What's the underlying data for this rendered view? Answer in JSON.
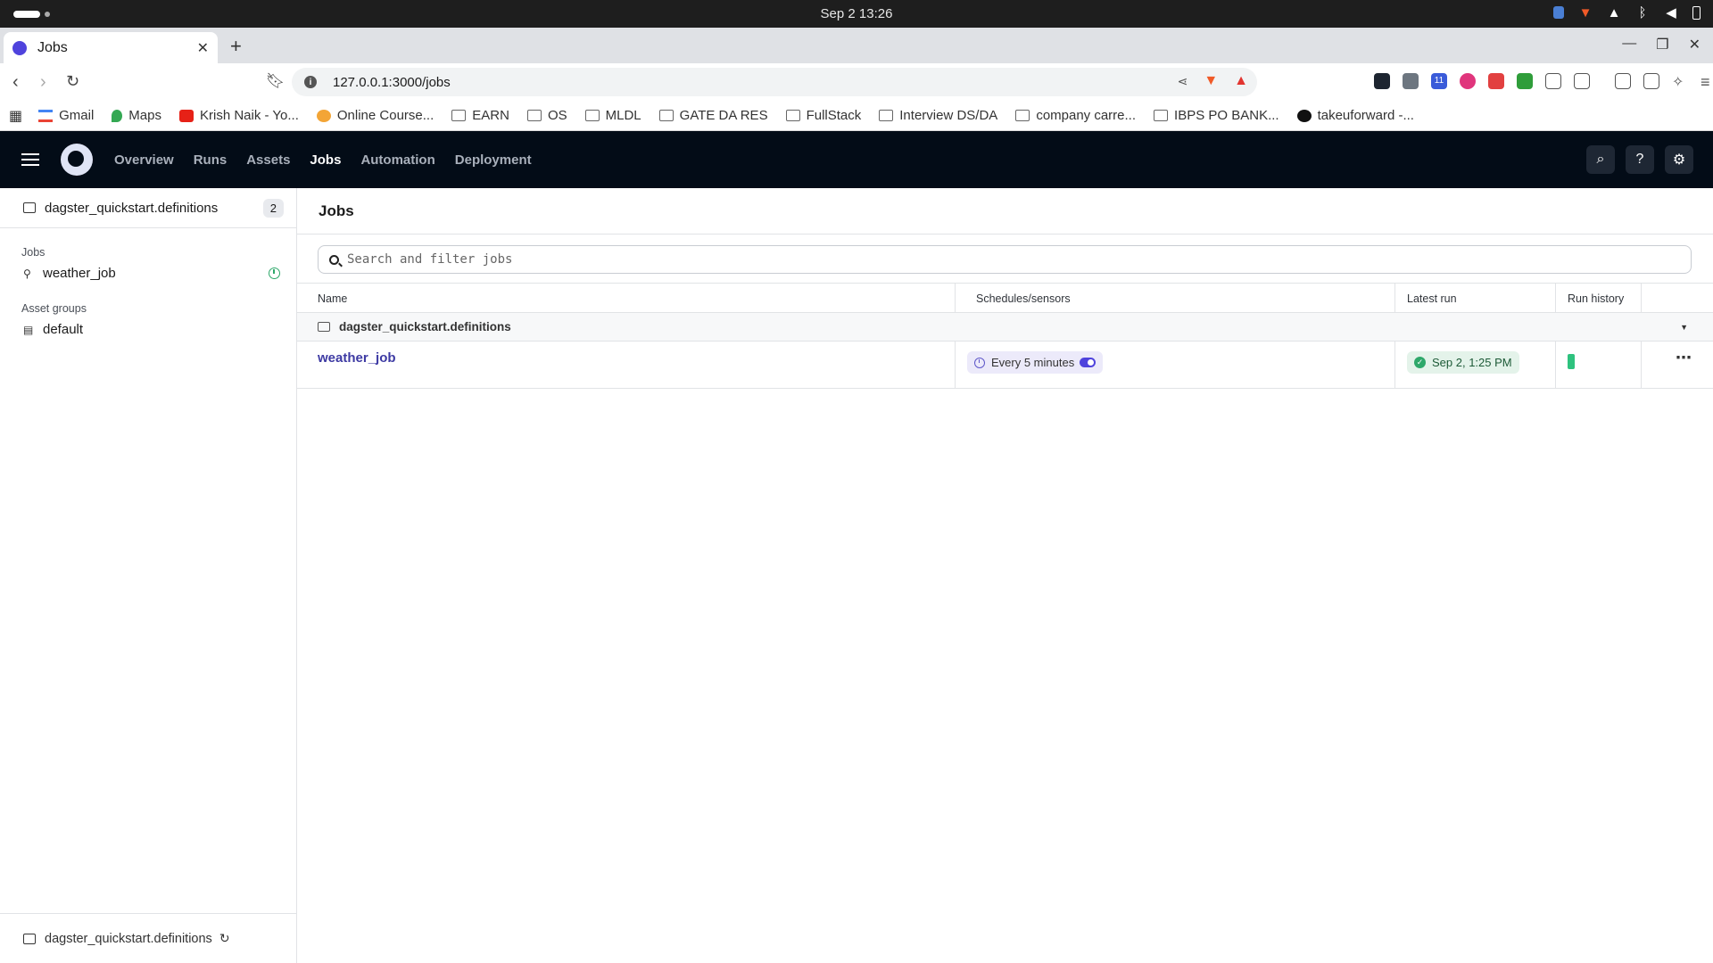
{
  "os": {
    "clock": "Sep 2  13:26"
  },
  "browser": {
    "tab_title": "Jobs",
    "url": "127.0.0.1:3000/jobs",
    "bookmarks": [
      {
        "label": "Gmail",
        "icon": "gmail-icon"
      },
      {
        "label": "Maps",
        "icon": "maps-icon"
      },
      {
        "label": "Krish Naik - Yo...",
        "icon": "youtube-icon"
      },
      {
        "label": "Online Course...",
        "icon": "course-icon"
      },
      {
        "label": "EARN",
        "icon": "folder-icon"
      },
      {
        "label": "OS",
        "icon": "folder-icon"
      },
      {
        "label": "MLDL",
        "icon": "folder-icon"
      },
      {
        "label": "GATE DA RES",
        "icon": "folder-icon"
      },
      {
        "label": "FullStack",
        "icon": "folder-icon"
      },
      {
        "label": "Interview DS/DA",
        "icon": "folder-icon"
      },
      {
        "label": "company carre...",
        "icon": "folder-icon"
      },
      {
        "label": "IBPS PO BANK...",
        "icon": "folder-icon"
      },
      {
        "label": "takeuforward -...",
        "icon": "tuf-icon"
      }
    ],
    "extension_badge": "11"
  },
  "app": {
    "nav": [
      "Overview",
      "Runs",
      "Assets",
      "Jobs",
      "Automation",
      "Deployment"
    ],
    "active_nav": "Jobs"
  },
  "sidebar": {
    "location": "dagster_quickstart.definitions",
    "count": "2",
    "jobs_heading": "Jobs",
    "jobs": [
      "weather_job"
    ],
    "asset_groups_heading": "Asset groups",
    "asset_groups": [
      "default"
    ],
    "footer_location": "dagster_quickstart.definitions"
  },
  "main": {
    "title": "Jobs",
    "search_placeholder": "Search and filter jobs",
    "columns": [
      "Name",
      "Schedules/sensors",
      "Latest run",
      "Run history"
    ],
    "group": "dagster_quickstart.definitions",
    "rows": [
      {
        "name": "weather_job",
        "schedule": "Every 5 minutes",
        "latest_run": "Sep 2, 1:25 PM",
        "run_history_status": "success"
      }
    ]
  },
  "colors": {
    "app_header": "#030c17",
    "link": "#3d3aa3",
    "success": "#2ea86a",
    "schedule_tag": "#eceafa"
  }
}
